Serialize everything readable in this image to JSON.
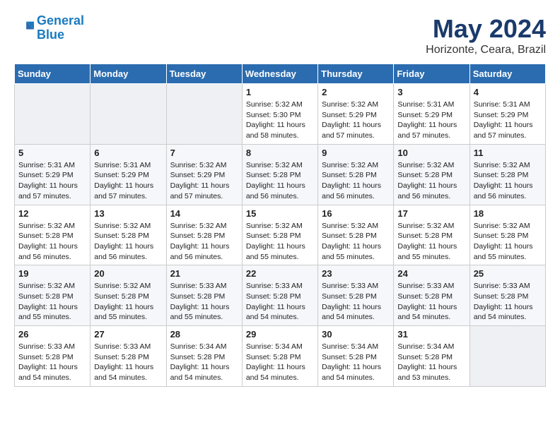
{
  "header": {
    "logo_line1": "General",
    "logo_line2": "Blue",
    "month": "May 2024",
    "location": "Horizonte, Ceara, Brazil"
  },
  "weekdays": [
    "Sunday",
    "Monday",
    "Tuesday",
    "Wednesday",
    "Thursday",
    "Friday",
    "Saturday"
  ],
  "weeks": [
    [
      {
        "day": "",
        "sunrise": "",
        "sunset": "",
        "daylight": ""
      },
      {
        "day": "",
        "sunrise": "",
        "sunset": "",
        "daylight": ""
      },
      {
        "day": "",
        "sunrise": "",
        "sunset": "",
        "daylight": ""
      },
      {
        "day": "1",
        "sunrise": "Sunrise: 5:32 AM",
        "sunset": "Sunset: 5:30 PM",
        "daylight": "Daylight: 11 hours and 58 minutes."
      },
      {
        "day": "2",
        "sunrise": "Sunrise: 5:32 AM",
        "sunset": "Sunset: 5:29 PM",
        "daylight": "Daylight: 11 hours and 57 minutes."
      },
      {
        "day": "3",
        "sunrise": "Sunrise: 5:31 AM",
        "sunset": "Sunset: 5:29 PM",
        "daylight": "Daylight: 11 hours and 57 minutes."
      },
      {
        "day": "4",
        "sunrise": "Sunrise: 5:31 AM",
        "sunset": "Sunset: 5:29 PM",
        "daylight": "Daylight: 11 hours and 57 minutes."
      }
    ],
    [
      {
        "day": "5",
        "sunrise": "Sunrise: 5:31 AM",
        "sunset": "Sunset: 5:29 PM",
        "daylight": "Daylight: 11 hours and 57 minutes."
      },
      {
        "day": "6",
        "sunrise": "Sunrise: 5:31 AM",
        "sunset": "Sunset: 5:29 PM",
        "daylight": "Daylight: 11 hours and 57 minutes."
      },
      {
        "day": "7",
        "sunrise": "Sunrise: 5:32 AM",
        "sunset": "Sunset: 5:29 PM",
        "daylight": "Daylight: 11 hours and 57 minutes."
      },
      {
        "day": "8",
        "sunrise": "Sunrise: 5:32 AM",
        "sunset": "Sunset: 5:28 PM",
        "daylight": "Daylight: 11 hours and 56 minutes."
      },
      {
        "day": "9",
        "sunrise": "Sunrise: 5:32 AM",
        "sunset": "Sunset: 5:28 PM",
        "daylight": "Daylight: 11 hours and 56 minutes."
      },
      {
        "day": "10",
        "sunrise": "Sunrise: 5:32 AM",
        "sunset": "Sunset: 5:28 PM",
        "daylight": "Daylight: 11 hours and 56 minutes."
      },
      {
        "day": "11",
        "sunrise": "Sunrise: 5:32 AM",
        "sunset": "Sunset: 5:28 PM",
        "daylight": "Daylight: 11 hours and 56 minutes."
      }
    ],
    [
      {
        "day": "12",
        "sunrise": "Sunrise: 5:32 AM",
        "sunset": "Sunset: 5:28 PM",
        "daylight": "Daylight: 11 hours and 56 minutes."
      },
      {
        "day": "13",
        "sunrise": "Sunrise: 5:32 AM",
        "sunset": "Sunset: 5:28 PM",
        "daylight": "Daylight: 11 hours and 56 minutes."
      },
      {
        "day": "14",
        "sunrise": "Sunrise: 5:32 AM",
        "sunset": "Sunset: 5:28 PM",
        "daylight": "Daylight: 11 hours and 56 minutes."
      },
      {
        "day": "15",
        "sunrise": "Sunrise: 5:32 AM",
        "sunset": "Sunset: 5:28 PM",
        "daylight": "Daylight: 11 hours and 55 minutes."
      },
      {
        "day": "16",
        "sunrise": "Sunrise: 5:32 AM",
        "sunset": "Sunset: 5:28 PM",
        "daylight": "Daylight: 11 hours and 55 minutes."
      },
      {
        "day": "17",
        "sunrise": "Sunrise: 5:32 AM",
        "sunset": "Sunset: 5:28 PM",
        "daylight": "Daylight: 11 hours and 55 minutes."
      },
      {
        "day": "18",
        "sunrise": "Sunrise: 5:32 AM",
        "sunset": "Sunset: 5:28 PM",
        "daylight": "Daylight: 11 hours and 55 minutes."
      }
    ],
    [
      {
        "day": "19",
        "sunrise": "Sunrise: 5:32 AM",
        "sunset": "Sunset: 5:28 PM",
        "daylight": "Daylight: 11 hours and 55 minutes."
      },
      {
        "day": "20",
        "sunrise": "Sunrise: 5:32 AM",
        "sunset": "Sunset: 5:28 PM",
        "daylight": "Daylight: 11 hours and 55 minutes."
      },
      {
        "day": "21",
        "sunrise": "Sunrise: 5:33 AM",
        "sunset": "Sunset: 5:28 PM",
        "daylight": "Daylight: 11 hours and 55 minutes."
      },
      {
        "day": "22",
        "sunrise": "Sunrise: 5:33 AM",
        "sunset": "Sunset: 5:28 PM",
        "daylight": "Daylight: 11 hours and 54 minutes."
      },
      {
        "day": "23",
        "sunrise": "Sunrise: 5:33 AM",
        "sunset": "Sunset: 5:28 PM",
        "daylight": "Daylight: 11 hours and 54 minutes."
      },
      {
        "day": "24",
        "sunrise": "Sunrise: 5:33 AM",
        "sunset": "Sunset: 5:28 PM",
        "daylight": "Daylight: 11 hours and 54 minutes."
      },
      {
        "day": "25",
        "sunrise": "Sunrise: 5:33 AM",
        "sunset": "Sunset: 5:28 PM",
        "daylight": "Daylight: 11 hours and 54 minutes."
      }
    ],
    [
      {
        "day": "26",
        "sunrise": "Sunrise: 5:33 AM",
        "sunset": "Sunset: 5:28 PM",
        "daylight": "Daylight: 11 hours and 54 minutes."
      },
      {
        "day": "27",
        "sunrise": "Sunrise: 5:33 AM",
        "sunset": "Sunset: 5:28 PM",
        "daylight": "Daylight: 11 hours and 54 minutes."
      },
      {
        "day": "28",
        "sunrise": "Sunrise: 5:34 AM",
        "sunset": "Sunset: 5:28 PM",
        "daylight": "Daylight: 11 hours and 54 minutes."
      },
      {
        "day": "29",
        "sunrise": "Sunrise: 5:34 AM",
        "sunset": "Sunset: 5:28 PM",
        "daylight": "Daylight: 11 hours and 54 minutes."
      },
      {
        "day": "30",
        "sunrise": "Sunrise: 5:34 AM",
        "sunset": "Sunset: 5:28 PM",
        "daylight": "Daylight: 11 hours and 54 minutes."
      },
      {
        "day": "31",
        "sunrise": "Sunrise: 5:34 AM",
        "sunset": "Sunset: 5:28 PM",
        "daylight": "Daylight: 11 hours and 53 minutes."
      },
      {
        "day": "",
        "sunrise": "",
        "sunset": "",
        "daylight": ""
      }
    ]
  ]
}
